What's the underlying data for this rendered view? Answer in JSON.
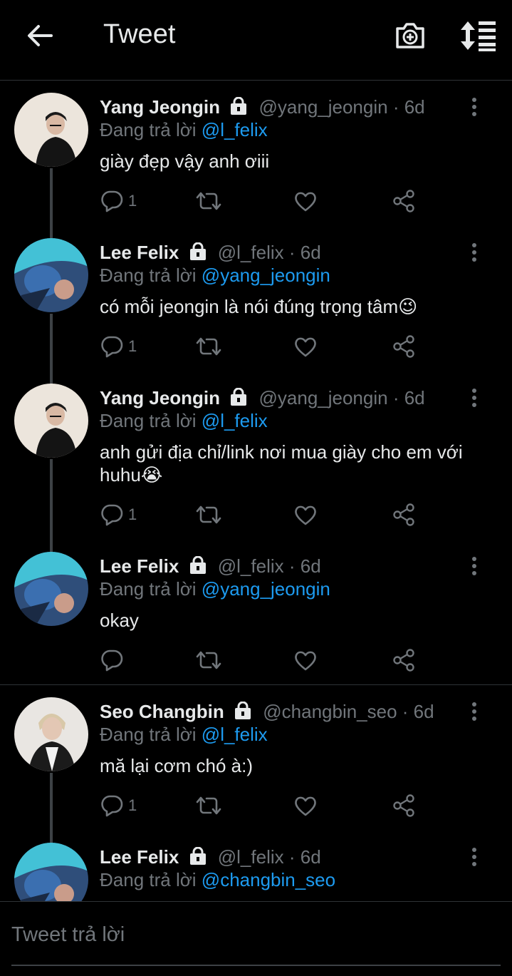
{
  "header": {
    "title": "Tweet",
    "icons": [
      "back-arrow-icon",
      "camera-plus-icon",
      "sort-icon"
    ]
  },
  "replying_prefix": "Đang trả lời",
  "tweets": [
    {
      "name": "Yang Jeongin",
      "handle": "@yang_jeongin",
      "time": "· 6d",
      "reply_to": "@l_felix",
      "text": "giày đẹp vậy anh ơiii",
      "reply_count": "1"
    },
    {
      "name": "Lee Felix",
      "handle": "@l_felix",
      "time": "· 6d",
      "reply_to": "@yang_jeongin",
      "text": "có mỗi jeongin là nói đúng trọng tâm😉",
      "reply_count": "1"
    },
    {
      "name": "Yang Jeongin",
      "handle": "@yang_jeongin",
      "time": "· 6d",
      "reply_to": "@l_felix",
      "text": "anh gửi địa chỉ/link nơi mua giày cho em với huhu😭",
      "reply_count": "1"
    },
    {
      "name": "Lee Felix",
      "handle": "@l_felix",
      "time": "· 6d",
      "reply_to": "@yang_jeongin",
      "text": "okay",
      "reply_count": ""
    },
    {
      "name": "Seo Changbin",
      "handle": "@changbin_seo",
      "time": "· 6d",
      "reply_to": "@l_felix",
      "text": "mă lại cơm chó à:)",
      "reply_count": "1"
    },
    {
      "name": "Lee Felix",
      "handle": "@l_felix",
      "time": "· 6d",
      "reply_to": "@changbin_seo",
      "text": "",
      "reply_count": ""
    }
  ],
  "composer": {
    "placeholder": "Tweet trả lời"
  },
  "colors": {
    "accent": "#1d9bf0",
    "muted": "#71767b",
    "bg": "#000000",
    "text": "#e7e9ea"
  }
}
